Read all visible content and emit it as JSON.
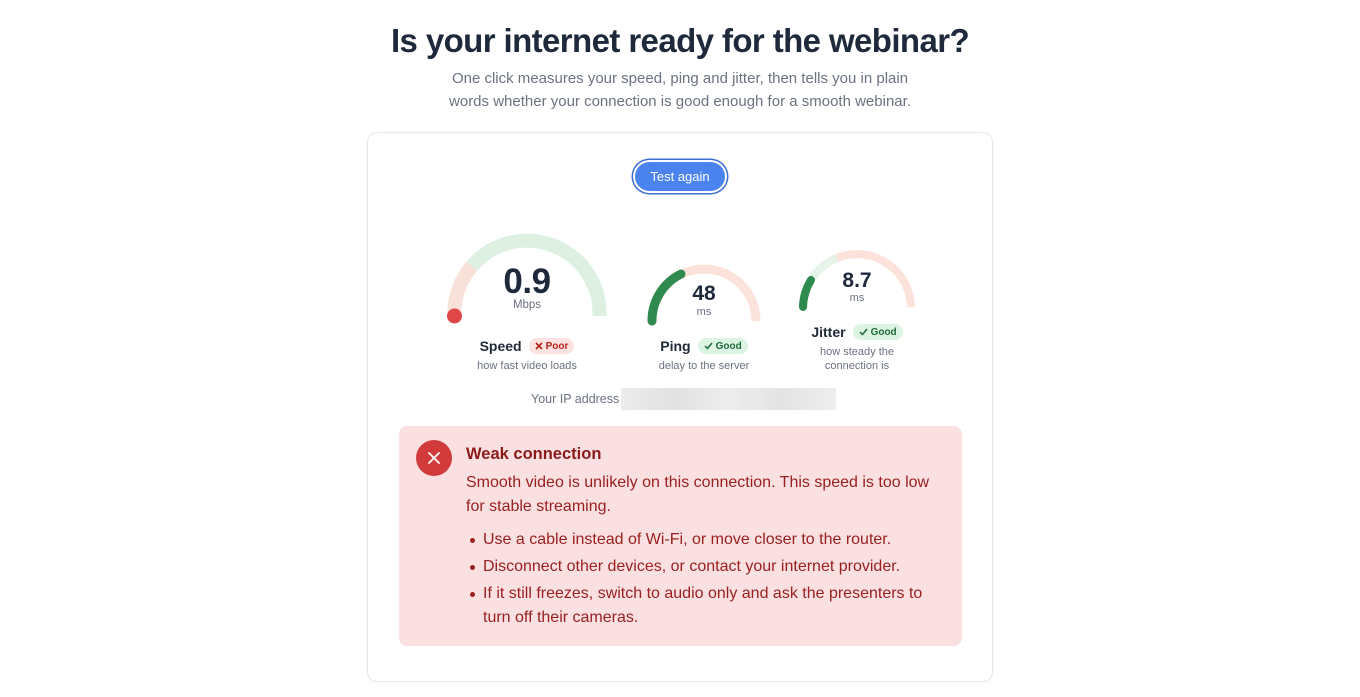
{
  "header": {
    "title": "Is your internet ready for the webinar?",
    "subtitle": "One click measures your speed, ping and jitter, then tells you in plain words whether your connection is good enough for a smooth webinar."
  },
  "test_button": {
    "label": "Test again"
  },
  "metrics": {
    "speed": {
      "value": "0.9",
      "unit": "Mbps",
      "name": "Speed",
      "status": "Poor",
      "status_icon": "x-icon",
      "description": "how fast video loads",
      "gauge_fill": 0.0,
      "indicator_color": "#e04848"
    },
    "ping": {
      "value": "48",
      "unit": "ms",
      "name": "Ping",
      "status": "Good",
      "status_icon": "check-icon",
      "description": "delay to the server",
      "gauge_fill": 0.36,
      "indicator_color": "#2f8a4f"
    },
    "jitter": {
      "value": "8.7",
      "unit": "ms",
      "name": "Jitter",
      "status": "Good",
      "status_icon": "check-icon",
      "description": "how steady the connection is",
      "gauge_fill": 0.17,
      "indicator_color": "#2f8a4f"
    }
  },
  "ip": {
    "label": "Your IP address"
  },
  "result": {
    "icon": "close-icon",
    "title": "Weak connection",
    "text": "Smooth video is unlikely on this connection. This speed is too low for stable streaming.",
    "tips": [
      "Use a cable instead of Wi-Fi, or move closer to the router.",
      "Disconnect other devices, or contact your internet provider.",
      "If it still freezes, switch to audio only and ask the presenters to turn off their cameras."
    ]
  },
  "colors": {
    "accent": "#4b84ee",
    "good": "#2f8a4f",
    "poor": "#e04848",
    "alert_bg": "#fae0e0",
    "alert_text": "#9b2020"
  }
}
